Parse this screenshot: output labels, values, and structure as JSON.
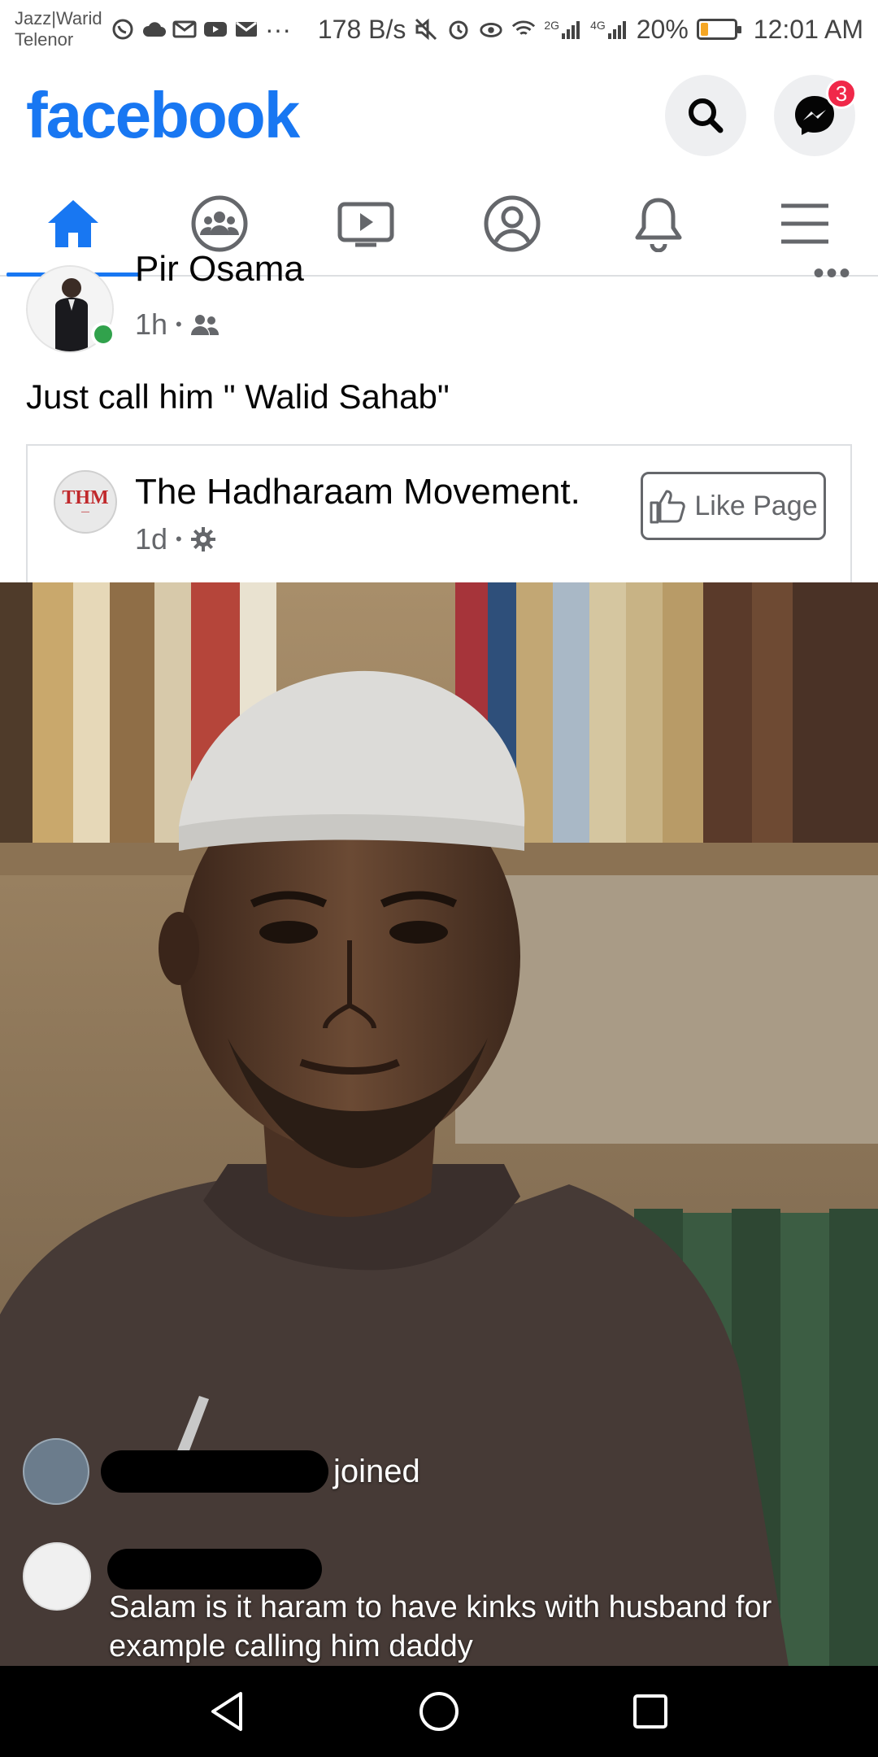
{
  "status_bar": {
    "carrier_line1": "Jazz|Warid",
    "carrier_line2": "Telenor",
    "dots": "···",
    "net_speed": "178 B/s",
    "signal_2g": "2G",
    "signal_4g": "4G",
    "battery_percent": "20%",
    "battery_level": 0.2,
    "time": "12:01 AM"
  },
  "header": {
    "logo": "facebook",
    "messenger_badge": "3",
    "brand_color": "#1877f2"
  },
  "tabs": [
    {
      "name": "home",
      "icon": "home-icon",
      "active": true
    },
    {
      "name": "groups",
      "icon": "groups-icon"
    },
    {
      "name": "watch",
      "icon": "video-icon"
    },
    {
      "name": "profile",
      "icon": "profile-icon"
    },
    {
      "name": "notifications",
      "icon": "bell-icon"
    },
    {
      "name": "menu",
      "icon": "menu-icon"
    }
  ],
  "post": {
    "author": "Pir Osama",
    "time": "1h",
    "dot": "•",
    "more": "•••",
    "caption": "Just call him \" Walid Sahab\""
  },
  "shared": {
    "page_logo_text": "THM",
    "page_name": "The Hadharaam Movement.",
    "time": "1d",
    "dot": "•",
    "like_button": "Like Page"
  },
  "photo": {
    "joined_text": "joined",
    "comment_text": "Salam is it haram to have kinks with husband for example calling him daddy"
  }
}
